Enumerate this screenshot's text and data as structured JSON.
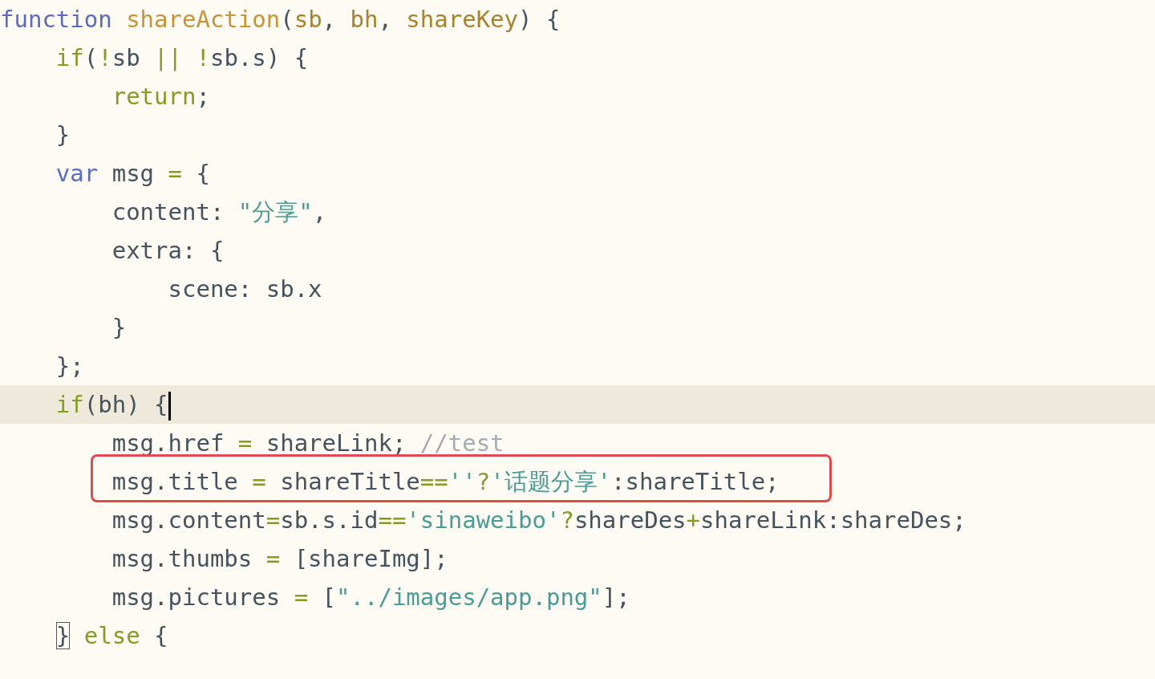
{
  "editor": {
    "lines": [
      {
        "current": false,
        "annotated": false,
        "cursor": false,
        "matched_bracket": false,
        "tokens": [
          {
            "text": "function ",
            "kind": "keyword"
          },
          {
            "text": "shareAction",
            "kind": "function"
          },
          {
            "text": "(",
            "kind": "plain"
          },
          {
            "text": "sb",
            "kind": "param"
          },
          {
            "text": ", ",
            "kind": "plain"
          },
          {
            "text": "bh",
            "kind": "param"
          },
          {
            "text": ", ",
            "kind": "plain"
          },
          {
            "text": "shareKey",
            "kind": "param"
          },
          {
            "text": ") {",
            "kind": "plain"
          }
        ]
      },
      {
        "current": false,
        "annotated": false,
        "cursor": false,
        "matched_bracket": false,
        "tokens": [
          {
            "text": "    if",
            "kind": "control"
          },
          {
            "text": "(",
            "kind": "plain"
          },
          {
            "text": "!",
            "kind": "operator"
          },
          {
            "text": "sb ",
            "kind": "plain"
          },
          {
            "text": "|| !",
            "kind": "operator"
          },
          {
            "text": "sb.s) {",
            "kind": "plain"
          }
        ]
      },
      {
        "current": false,
        "annotated": false,
        "cursor": false,
        "matched_bracket": false,
        "tokens": [
          {
            "text": "        return",
            "kind": "control"
          },
          {
            "text": ";",
            "kind": "plain"
          }
        ]
      },
      {
        "current": false,
        "annotated": false,
        "cursor": false,
        "matched_bracket": false,
        "tokens": [
          {
            "text": "    }",
            "kind": "plain"
          }
        ]
      },
      {
        "current": false,
        "annotated": false,
        "cursor": false,
        "matched_bracket": false,
        "tokens": [
          {
            "text": "    var",
            "kind": "keyword"
          },
          {
            "text": " msg ",
            "kind": "plain"
          },
          {
            "text": "=",
            "kind": "operator"
          },
          {
            "text": " {",
            "kind": "plain"
          }
        ]
      },
      {
        "current": false,
        "annotated": false,
        "cursor": false,
        "matched_bracket": false,
        "tokens": [
          {
            "text": "        content: ",
            "kind": "plain"
          },
          {
            "text": "\"分享\"",
            "kind": "string"
          },
          {
            "text": ",",
            "kind": "plain"
          }
        ]
      },
      {
        "current": false,
        "annotated": false,
        "cursor": false,
        "matched_bracket": false,
        "tokens": [
          {
            "text": "        extra: {",
            "kind": "plain"
          }
        ]
      },
      {
        "current": false,
        "annotated": false,
        "cursor": false,
        "matched_bracket": false,
        "tokens": [
          {
            "text": "            scene: sb.x",
            "kind": "plain"
          }
        ]
      },
      {
        "current": false,
        "annotated": false,
        "cursor": false,
        "matched_bracket": false,
        "tokens": [
          {
            "text": "        }",
            "kind": "plain"
          }
        ]
      },
      {
        "current": false,
        "annotated": false,
        "cursor": false,
        "matched_bracket": false,
        "tokens": [
          {
            "text": "    };",
            "kind": "plain"
          }
        ]
      },
      {
        "current": true,
        "annotated": false,
        "cursor": true,
        "matched_bracket": false,
        "tokens": [
          {
            "text": "    if",
            "kind": "control"
          },
          {
            "text": "(bh) {",
            "kind": "plain"
          }
        ]
      },
      {
        "current": false,
        "annotated": false,
        "cursor": false,
        "matched_bracket": false,
        "tokens": [
          {
            "text": "        msg.href ",
            "kind": "plain"
          },
          {
            "text": "=",
            "kind": "operator"
          },
          {
            "text": " shareLink; ",
            "kind": "plain"
          },
          {
            "text": "//test",
            "kind": "comment"
          }
        ]
      },
      {
        "current": false,
        "annotated": true,
        "cursor": false,
        "matched_bracket": false,
        "tokens": [
          {
            "text": "        msg.title ",
            "kind": "plain"
          },
          {
            "text": "=",
            "kind": "operator"
          },
          {
            "text": " shareTitle",
            "kind": "plain"
          },
          {
            "text": "==",
            "kind": "operator"
          },
          {
            "text": "''",
            "kind": "string"
          },
          {
            "text": "?",
            "kind": "operator"
          },
          {
            "text": "'话题分享'",
            "kind": "string"
          },
          {
            "text": ":shareTitle;",
            "kind": "plain"
          }
        ]
      },
      {
        "current": false,
        "annotated": false,
        "cursor": false,
        "matched_bracket": false,
        "tokens": [
          {
            "text": "        msg.content",
            "kind": "plain"
          },
          {
            "text": "=",
            "kind": "operator"
          },
          {
            "text": "sb.s.id",
            "kind": "plain"
          },
          {
            "text": "==",
            "kind": "operator"
          },
          {
            "text": "'sinaweibo'",
            "kind": "string"
          },
          {
            "text": "?",
            "kind": "operator"
          },
          {
            "text": "shareDes",
            "kind": "plain"
          },
          {
            "text": "+",
            "kind": "operator"
          },
          {
            "text": "shareLink:shareDes;",
            "kind": "plain"
          }
        ]
      },
      {
        "current": false,
        "annotated": false,
        "cursor": false,
        "matched_bracket": false,
        "tokens": [
          {
            "text": "        msg.thumbs ",
            "kind": "plain"
          },
          {
            "text": "=",
            "kind": "operator"
          },
          {
            "text": " [shareImg];",
            "kind": "plain"
          }
        ]
      },
      {
        "current": false,
        "annotated": false,
        "cursor": false,
        "matched_bracket": false,
        "tokens": [
          {
            "text": "        msg.pictures ",
            "kind": "plain"
          },
          {
            "text": "=",
            "kind": "operator"
          },
          {
            "text": " [",
            "kind": "plain"
          },
          {
            "text": "\"../images/app.png\"",
            "kind": "string"
          },
          {
            "text": "];",
            "kind": "plain"
          }
        ]
      },
      {
        "current": false,
        "annotated": false,
        "cursor": false,
        "matched_bracket": true,
        "tokens": [
          {
            "text": "    }",
            "kind": "plain"
          },
          {
            "text": " else",
            "kind": "control"
          },
          {
            "text": " {",
            "kind": "plain"
          }
        ]
      }
    ]
  }
}
